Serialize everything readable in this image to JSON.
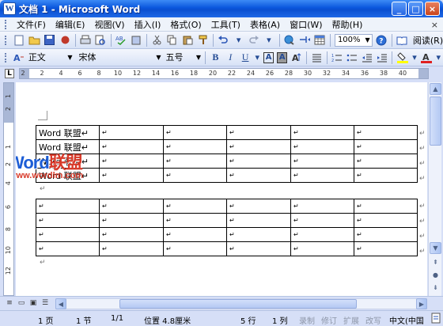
{
  "window": {
    "title": "文档 1 - Microsoft Word",
    "min": "_",
    "max": "□",
    "close": "×"
  },
  "menu": {
    "items": [
      "文件(F)",
      "编辑(E)",
      "视图(V)",
      "插入(I)",
      "格式(O)",
      "工具(T)",
      "表格(A)",
      "窗口(W)",
      "帮助(H)"
    ],
    "close_doc": "×"
  },
  "toolbar": {
    "zoom": "100%",
    "read": "阅读(R)"
  },
  "format_toolbar": {
    "style": "正文",
    "font": "宋体",
    "size": "五号",
    "bold": "B",
    "italic": "I",
    "underline": "U"
  },
  "ruler": {
    "corner": "L",
    "h_ticks": [
      "2",
      "2",
      "4",
      "6",
      "8",
      "10",
      "12",
      "14",
      "16",
      "18",
      "20",
      "22",
      "24",
      "26",
      "28",
      "30",
      "32",
      "34",
      "36",
      "38",
      "40"
    ],
    "v_ticks": [
      "1",
      "2",
      "1",
      "2",
      "4",
      "6",
      "8",
      "10",
      "12"
    ]
  },
  "document": {
    "table1": [
      [
        "Word 联盟↵",
        "↵",
        "↵",
        "↵",
        "↵",
        "↵"
      ],
      [
        "Word 联盟↵",
        "↵",
        "↵",
        "↵",
        "↵",
        "↵"
      ],
      [
        "Word 联盟↵",
        "↵",
        "↵",
        "↵",
        "↵",
        "↵"
      ],
      [
        "Word 联盟↵",
        "↵",
        "↵",
        "↵",
        "↵",
        "↵"
      ]
    ],
    "table2": [
      [
        "↵",
        "↵",
        "↵",
        "↵",
        "↵",
        "↵"
      ],
      [
        "↵",
        "↵",
        "↵",
        "↵",
        "↵",
        "↵"
      ],
      [
        "↵",
        "↵",
        "↵",
        "↵",
        "↵",
        "↵"
      ],
      [
        "↵",
        "↵",
        "↵",
        "↵",
        "↵",
        "↵"
      ]
    ],
    "para_mark": "↵",
    "watermark_blue": "Word",
    "watermark_red": "联盟",
    "watermark_url": "www.wordlm.com"
  },
  "status": {
    "page": "1 页",
    "section": "1 节",
    "page_of": "1/1",
    "position": "位置 4.8厘米",
    "line": "5 行",
    "column": "1 列",
    "rec": "录制",
    "trk": "修订",
    "ext": "扩展",
    "ovr": "改写",
    "lang": "中文(中国"
  }
}
